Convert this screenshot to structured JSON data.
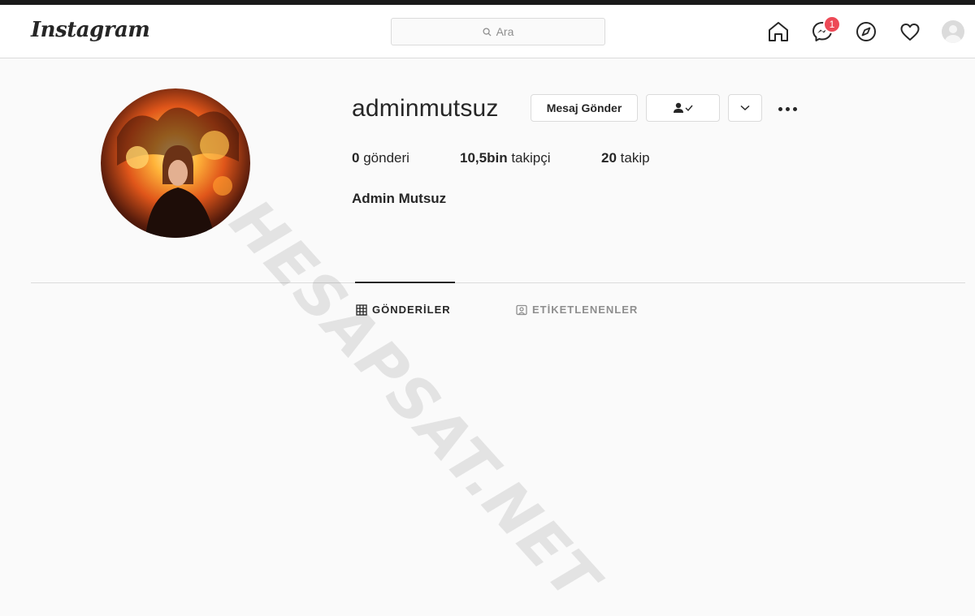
{
  "nav": {
    "logo": "Instagram",
    "search_placeholder": "Ara",
    "notification_count": "1",
    "icons": [
      "home-icon",
      "messenger-icon",
      "explore-icon",
      "activity-heart-icon",
      "profile-avatar"
    ]
  },
  "profile": {
    "username": "adminmutsuz",
    "message_button": "Mesaj Gönder",
    "following_button_icon": "person-check-icon",
    "dropdown_icon": "chevron-down-icon",
    "more_icon": "more-options-icon",
    "stats": {
      "posts_count": "0",
      "posts_label": "gönderi",
      "followers_count": "10,5bin",
      "followers_label": "takipçi",
      "following_count": "20",
      "following_label": "takip"
    },
    "full_name": "Admin Mutsuz"
  },
  "tabs": [
    {
      "label": "GÖNDERİLER",
      "active": true
    },
    {
      "label": "ETİKETLENENLER",
      "active": false
    }
  ],
  "watermark": "HESAPSAT.NET",
  "colors": {
    "accent_badge": "#ed4956",
    "border": "#dbdbdb",
    "text": "#262626",
    "muted": "#8e8e8e"
  }
}
